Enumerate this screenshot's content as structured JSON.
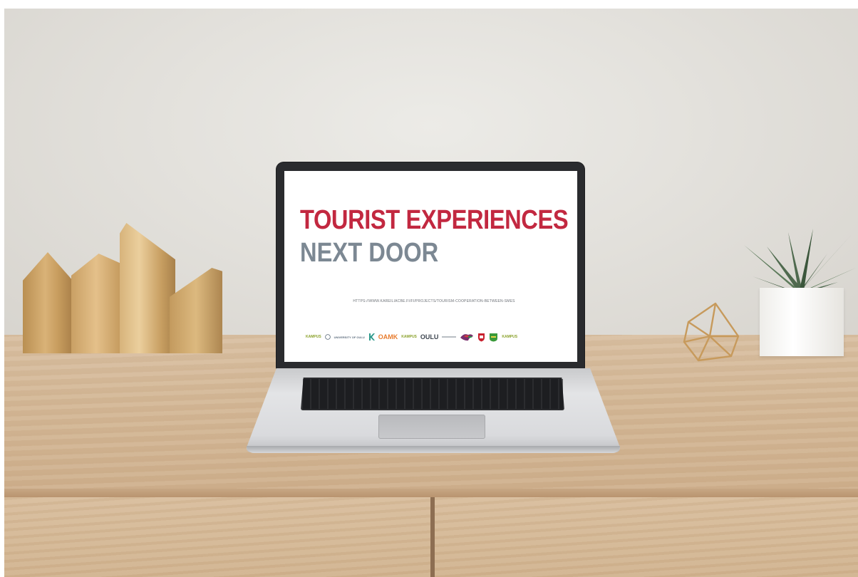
{
  "screen": {
    "title_line1": "TOURIST EXPERIENCES",
    "title_line2": "NEXT DOOR",
    "url": "HTTPS://WWW.KAREILIACBE.FI/FI/PROJECTS/TOURISM-COOPERATION-BETWEEN-SMES",
    "title_color": "#c22840",
    "subtitle_color": "#7c8893",
    "logos": {
      "kampus1": "KAMPUS",
      "university": "UNIVERSITY OF OULU",
      "oamk": "OAMK",
      "kampus2": "KAMPUS",
      "oulu": "OULU",
      "kampus3": "KAMPUS"
    }
  },
  "icons": [
    "laptop-icon",
    "gold-sculpture",
    "plant-icon",
    "geometric-ornament"
  ]
}
